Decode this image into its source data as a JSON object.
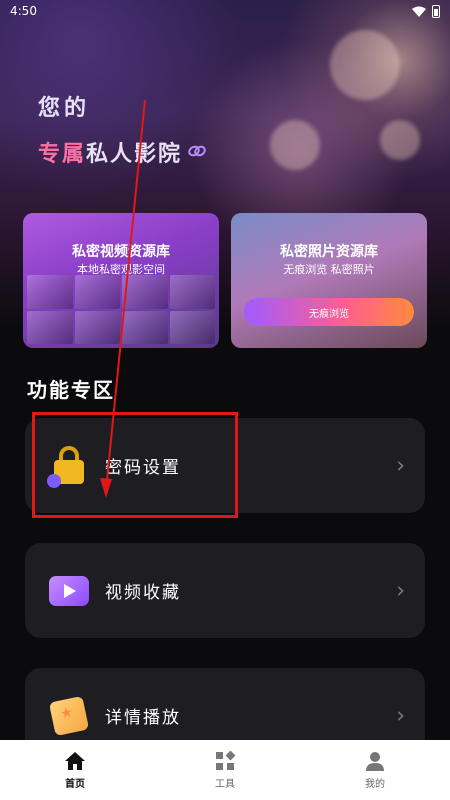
{
  "status_bar": {
    "time": "4:50"
  },
  "hero": {
    "line1": "您的",
    "line2_highlight": "专属",
    "line2_rest": "私人影院",
    "link_icon": "link-icon"
  },
  "cards": [
    {
      "title": "私密视频资源库",
      "subtitle": "本地私密观影空间"
    },
    {
      "title": "私密照片资源库",
      "subtitle": "无痕浏览 私密照片",
      "button": "无痕浏览"
    }
  ],
  "section": {
    "title": "功能专区"
  },
  "features": [
    {
      "label": "密码设置",
      "icon": "lock-icon"
    },
    {
      "label": "视频收藏",
      "icon": "video-icon"
    },
    {
      "label": "详情播放",
      "icon": "book-icon"
    }
  ],
  "bottom_nav": [
    {
      "label": "首页",
      "icon": "home-icon",
      "active": true
    },
    {
      "label": "工具",
      "icon": "tools-icon",
      "active": false
    },
    {
      "label": "我的",
      "icon": "user-icon",
      "active": false
    }
  ],
  "colors": {
    "accent_pink": "#ff6fa0",
    "annotation_red": "#e01818",
    "card_bg": "#1e1e22"
  }
}
